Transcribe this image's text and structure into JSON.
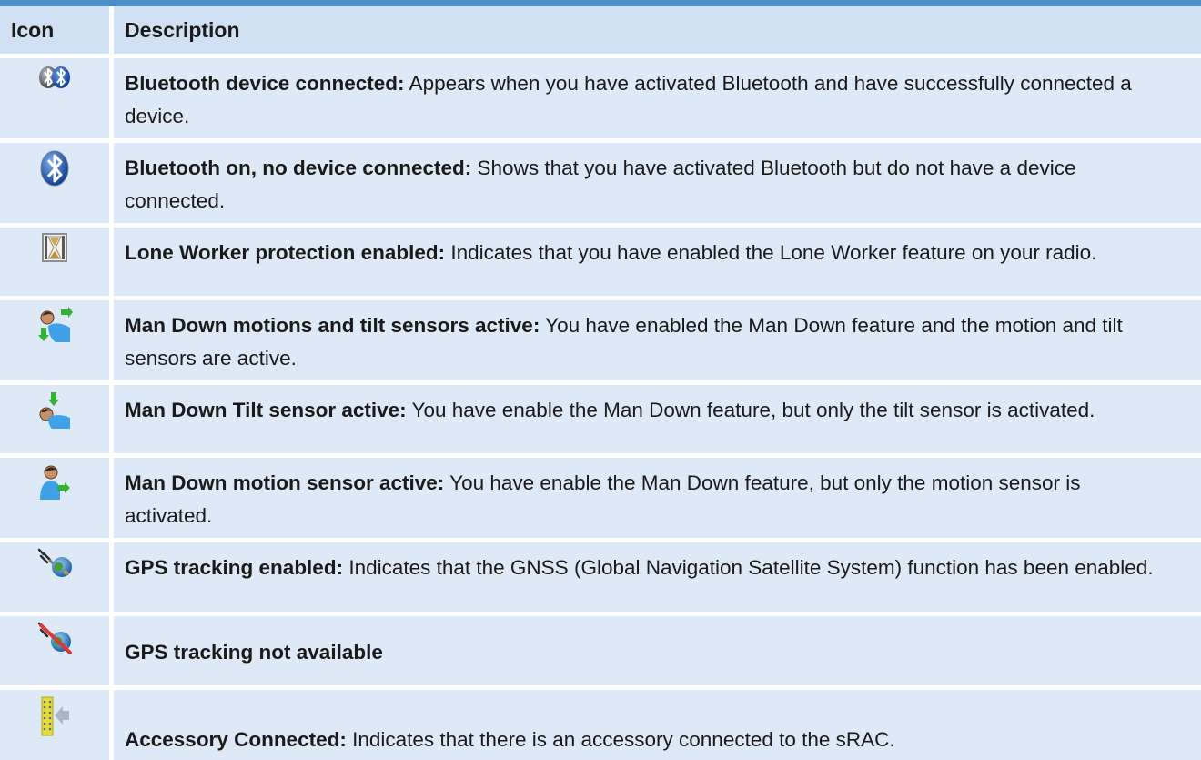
{
  "table": {
    "headers": {
      "icon": "Icon",
      "description": "Description"
    },
    "rows": [
      {
        "icon": "bluetooth-connected-icon",
        "term": "Bluetooth device connected:",
        "text": " Appears when you have activated Bluetooth and have successfully connected a device."
      },
      {
        "icon": "bluetooth-on-icon",
        "term": "Bluetooth on, no device connected:",
        "text": " Shows that you have activated Bluetooth but do not have a device connected."
      },
      {
        "icon": "hourglass-icon",
        "term": "Lone Worker protection enabled:",
        "text": " Indicates that you have enabled the Lone Worker feature on your radio."
      },
      {
        "icon": "man-down-motion-tilt-icon",
        "term": "Man Down motions and tilt sensors active:",
        "text": " You have enabled the Man Down feature and the motion and tilt sensors are active."
      },
      {
        "icon": "man-down-tilt-icon",
        "term": "Man Down Tilt sensor active:",
        "text": " You have enable the Man Down feature, but only the tilt sensor is activated."
      },
      {
        "icon": "man-down-motion-icon",
        "term": "Man Down motion sensor active:",
        "text": " You have enable the Man Down feature, but only the motion sensor is activated."
      },
      {
        "icon": "gps-satellite-globe-icon",
        "term": "GPS tracking enabled:",
        "text": " Indicates that the GNSS (Global Navigation Satellite System) function has been enabled."
      },
      {
        "icon": "gps-unavailable-icon",
        "term": "GPS tracking not available",
        "text": ""
      },
      {
        "icon": "accessory-connected-icon",
        "term": "Accessory Connected:",
        "text": " Indicates that there is an accessory connected to the sRAC."
      }
    ]
  },
  "colors": {
    "accent_bar": "#4a90c8",
    "header_bg": "#cfe1f3",
    "row_bg": "#dde9f6"
  }
}
